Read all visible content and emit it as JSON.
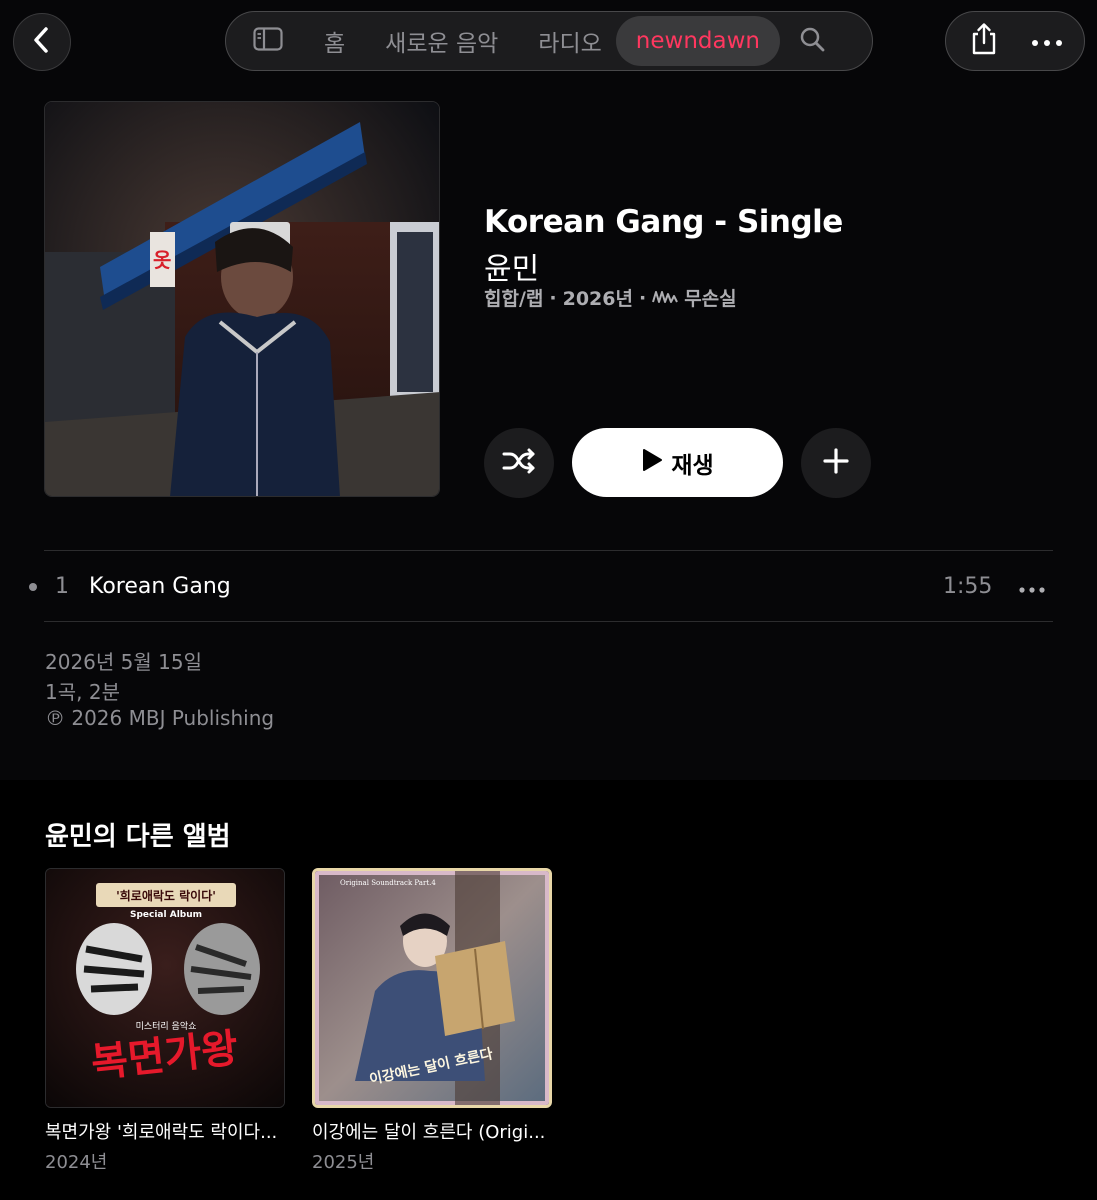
{
  "nav": {
    "back_icon": "chevron-left-icon",
    "sidebar_icon": "sidebar-icon",
    "tabs": [
      {
        "label": "홈"
      },
      {
        "label": "새로운 음악"
      },
      {
        "label": "라디오"
      },
      {
        "label": "newndawn"
      }
    ],
    "active_tab": "newndawn",
    "active_color": "#ff375f",
    "search_icon": "search-icon",
    "share_icon": "share-icon",
    "more_icon": "ellipsis-icon"
  },
  "album": {
    "title": "Korean Gang - Single",
    "artist": "윤민",
    "genre": "힙합/랩",
    "year": "2026년",
    "separator": "·",
    "lossless_label": "무손실",
    "lossless_icon": "lossless-waveform-icon",
    "shuffle_icon": "shuffle-icon",
    "play_label": "재생",
    "play_icon": "play-icon",
    "add_icon": "plus-icon"
  },
  "tracks": [
    {
      "number": "1",
      "title": "Korean Gang",
      "duration": "1:55"
    }
  ],
  "info": {
    "release_date": "2026년 5월 15일",
    "summary": "1곡, 2분",
    "copyright": "℗ 2026 MBJ Publishing"
  },
  "other_albums": {
    "heading": "윤민의 다른 앨범",
    "items": [
      {
        "name": "복면가왕 '희로애락도 락이다...",
        "year": "2024년",
        "cover_text_top": "'희로애락도 락이다'",
        "cover_text_sub": "Special Album",
        "cover_text_small": "미스터리 음악쇼",
        "cover_text_big": "복면가왕"
      },
      {
        "name": "이강에는 달이 흐른다 (Origi...",
        "year": "2025년",
        "cover_text_top": "Original Soundtrack Part.4",
        "cover_text_big": "이강에는 달이 흐른다"
      }
    ]
  }
}
